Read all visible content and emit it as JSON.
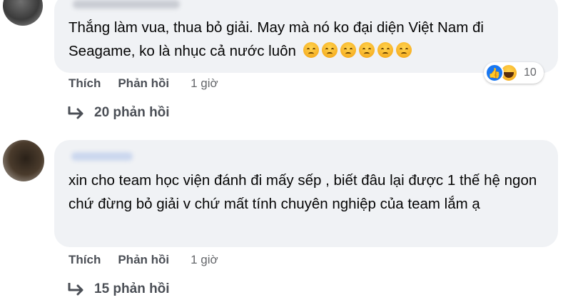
{
  "comments": [
    {
      "text": "Thắng làm vua, thua bỏ giải. May mà nó ko đại diện Việt Nam đi Seagame, ko là nhục cả nước luôn",
      "emoji_icon": "weary-face-emoji",
      "emoji_count": 6,
      "reactions": {
        "icons": [
          "like-icon",
          "haha-icon"
        ],
        "count": "10"
      },
      "actions": {
        "like": "Thích",
        "reply": "Phản hồi",
        "time": "1 giờ"
      },
      "replies": "20 phản hồi"
    },
    {
      "text": "xin cho team học viện đánh đi mấy sếp , biết đâu lại được 1 thế hệ ngon chứ đừng bỏ giải v chứ mất tính chuyên nghiệp của team lắm ạ",
      "actions": {
        "like": "Thích",
        "reply": "Phản hồi",
        "time": "1 giờ"
      },
      "replies": "15 phản hồi"
    }
  ],
  "colors": {
    "bubble": "#f0f2f5",
    "text": "#050505",
    "muted": "#65676b",
    "like_blue": "#1877f2"
  }
}
